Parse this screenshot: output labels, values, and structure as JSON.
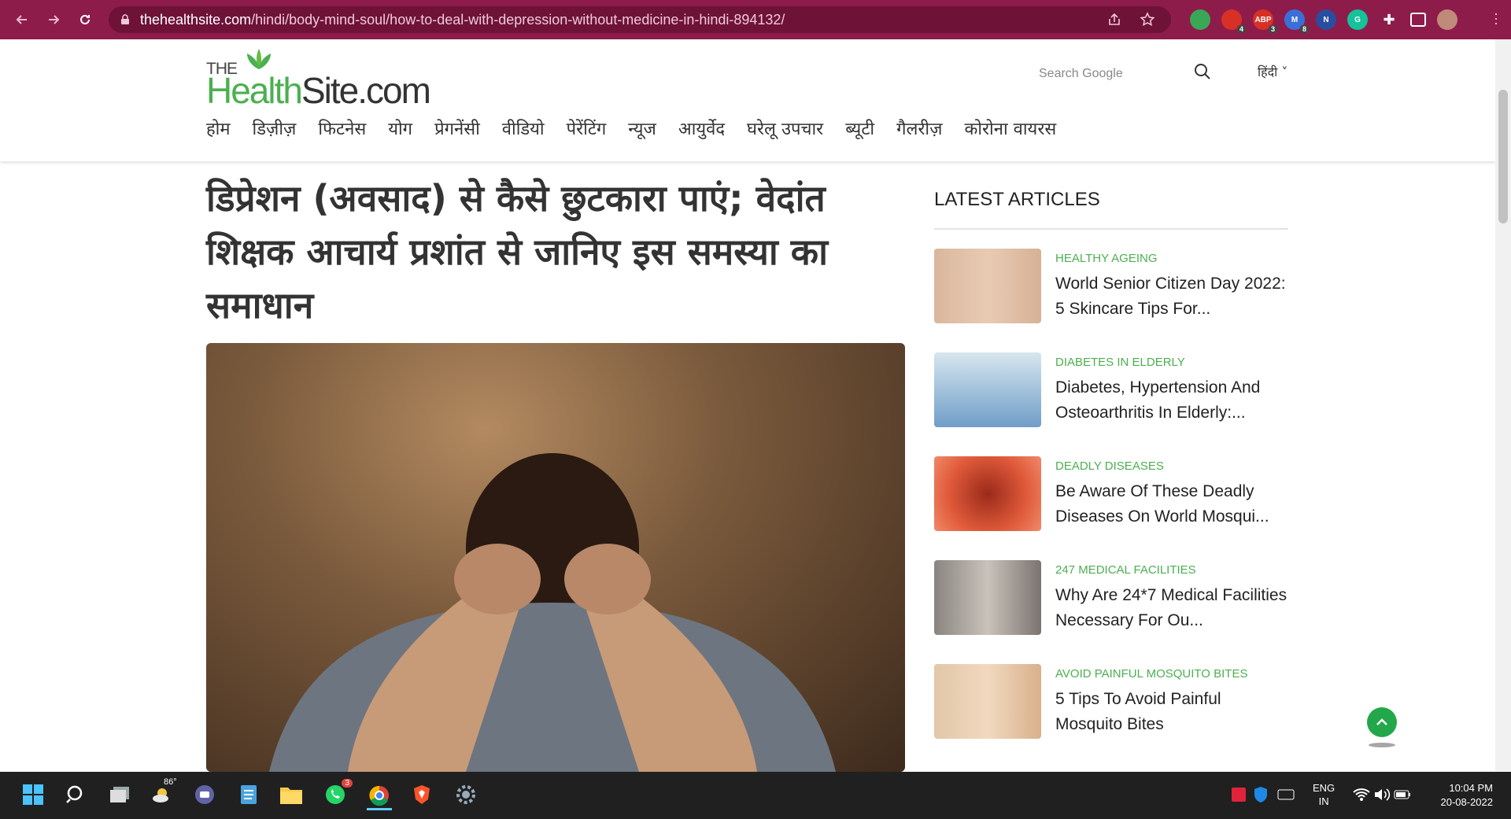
{
  "browser": {
    "url_host": "thehealthsite.com",
    "url_path": "/hindi/body-mind-soul/how-to-deal-with-depression-without-medicine-in-hindi-894132/",
    "extensions": [
      {
        "name": "colorful-extension-icon",
        "color": "#3aa757",
        "badge": ""
      },
      {
        "name": "red-extension-icon",
        "color": "#d93025",
        "badge": "4"
      },
      {
        "name": "abp-icon",
        "color": "#d93025",
        "badge": "3"
      },
      {
        "name": "m-extension-icon",
        "color": "#3b6fd8",
        "badge": "8"
      },
      {
        "name": "n-extension-icon",
        "color": "#2a4e9f",
        "badge": ""
      },
      {
        "name": "grammarly-icon",
        "color": "#15c39a",
        "badge": ""
      }
    ]
  },
  "header": {
    "logo_the": "THE",
    "logo_health": "Health",
    "logo_site": "Site.com",
    "search_placeholder": "Search Google",
    "lang": "हिंदी ˅",
    "nav": [
      "होम",
      "डिज़ीज़",
      "फिटनेस",
      "योग",
      "प्रेगनेंसी",
      "वीडियो",
      "पेरेंटिंग",
      "न्यूज",
      "आयुर्वेद",
      "घरेलू उपचार",
      "ब्यूटी",
      "गैलरीज़",
      "कोरोना वायरस"
    ]
  },
  "article": {
    "title": "डिप्रेशन (अवसाद) से कैसे छुटकारा पाएं; वेदांत शिक्षक आचार्य प्रशांत से जानिए इस समस्या का समाधान"
  },
  "sidebar": {
    "heading": "LATEST ARTICLES",
    "articles": [
      {
        "category": "HEALTHY AGEING",
        "title": "World Senior Citizen Day 2022: 5 Skincare Tips For..."
      },
      {
        "category": "DIABETES IN ELDERLY",
        "title": "Diabetes, Hypertension And Osteoarthritis In Elderly:..."
      },
      {
        "category": "DEADLY DISEASES",
        "title": "Be Aware Of These Deadly Diseases On World Mosqui..."
      },
      {
        "category": "247 MEDICAL FACILITIES",
        "title": "Why Are 24*7 Medical Facilities Necessary For Ou..."
      },
      {
        "category": "AVOID PAINFUL MOSQUITO BITES",
        "title": "5 Tips To Avoid Painful Mosquito Bites"
      }
    ]
  },
  "taskbar": {
    "weather": "86°",
    "whatsapp_badge": "3",
    "lang_top": "ENG",
    "lang_bottom": "IN",
    "time": "10:04 PM",
    "date": "20-08-2022"
  }
}
